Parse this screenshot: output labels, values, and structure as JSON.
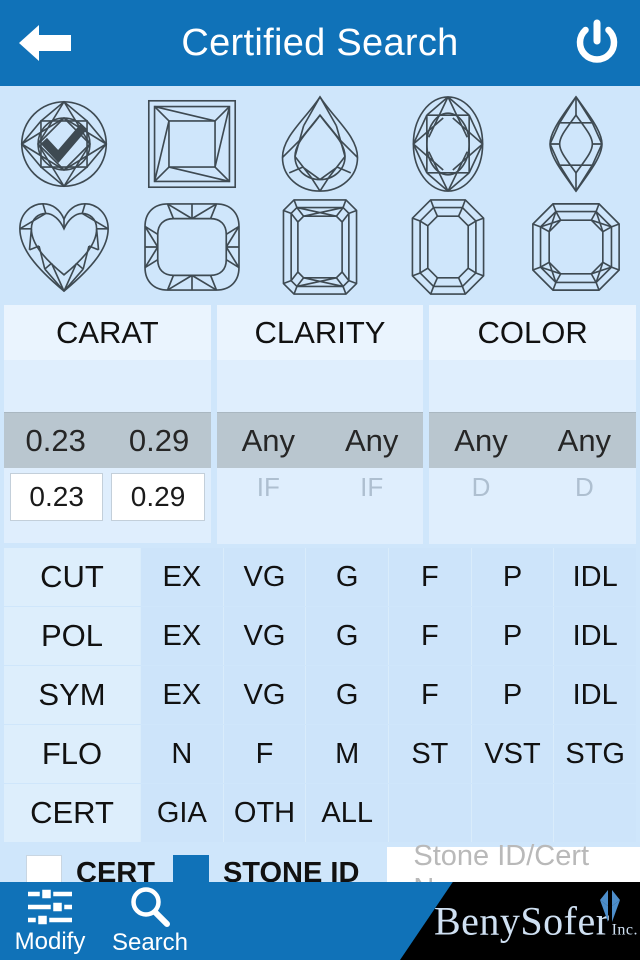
{
  "header": {
    "title": "Certified Search",
    "back_icon": "back-arrow-icon",
    "power_icon": "power-icon",
    "bg_color": "#1072b8"
  },
  "shapes": {
    "selected": "round",
    "check_icon": "checkmark-icon",
    "rows": [
      [
        {
          "id": "round",
          "label": "Round"
        },
        {
          "id": "princess",
          "label": "Princess"
        },
        {
          "id": "pear",
          "label": "Pear"
        },
        {
          "id": "oval",
          "label": "Oval"
        },
        {
          "id": "marquise",
          "label": "Marquise"
        }
      ],
      [
        {
          "id": "heart",
          "label": "Heart"
        },
        {
          "id": "cushion",
          "label": "Cushion"
        },
        {
          "id": "radiant",
          "label": "Radiant"
        },
        {
          "id": "emerald",
          "label": "Emerald"
        },
        {
          "id": "asscher",
          "label": "Asscher"
        }
      ]
    ]
  },
  "pickers": [
    {
      "id": "carat",
      "title": "CARAT",
      "selected": [
        "0.23",
        "0.29"
      ],
      "next": [
        "",
        ""
      ],
      "has_inputs": true,
      "inputs": [
        "0.23",
        "0.29"
      ]
    },
    {
      "id": "clarity",
      "title": "CLARITY",
      "selected": [
        "Any",
        "Any"
      ],
      "next": [
        "IF",
        "IF"
      ],
      "has_inputs": false,
      "inputs": []
    },
    {
      "id": "color",
      "title": "COLOR",
      "selected": [
        "Any",
        "Any"
      ],
      "next": [
        "D",
        "D"
      ],
      "has_inputs": false,
      "inputs": []
    }
  ],
  "grades": [
    {
      "label": "CUT",
      "values": [
        "EX",
        "VG",
        "G",
        "F",
        "P",
        "IDL"
      ]
    },
    {
      "label": "POL",
      "values": [
        "EX",
        "VG",
        "G",
        "F",
        "P",
        "IDL"
      ]
    },
    {
      "label": "SYM",
      "values": [
        "EX",
        "VG",
        "G",
        "F",
        "P",
        "IDL"
      ]
    },
    {
      "label": "FLO",
      "values": [
        "N",
        "F",
        "M",
        "ST",
        "VST",
        "STG"
      ]
    },
    {
      "label": "CERT",
      "values": [
        "GIA",
        "OTH",
        "ALL",
        "",
        "",
        ""
      ]
    }
  ],
  "id_row": {
    "cert_label": "CERT",
    "cert_checked": false,
    "stone_label": "STONE ID",
    "stone_checked": true,
    "input_value": "",
    "input_placeholder": "Stone ID/Cert No.",
    "checked_color": "#1072b8"
  },
  "tabbar": {
    "tabs": [
      {
        "id": "modify",
        "label": "Modify",
        "icon": "sliders-icon"
      },
      {
        "id": "search",
        "label": "Search",
        "icon": "magnifier-icon"
      }
    ],
    "logo": {
      "name": "BenySofer",
      "suffix": "Inc.",
      "mark_icon": "four-diamond-logo-icon"
    }
  }
}
